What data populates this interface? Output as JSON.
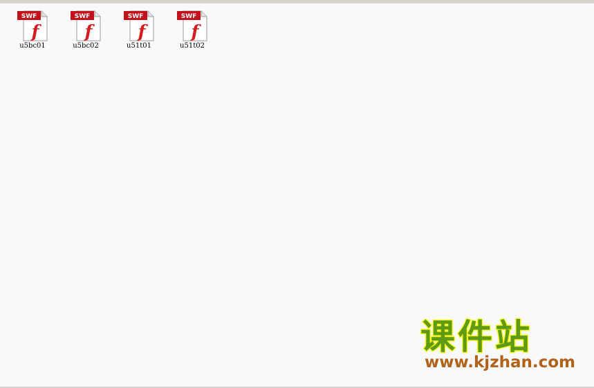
{
  "files": [
    {
      "name": "u5bc01",
      "icon": "swf-file-icon",
      "badge": "SWF"
    },
    {
      "name": "u5bc02",
      "icon": "swf-file-icon",
      "badge": "SWF"
    },
    {
      "name": "u51t01",
      "icon": "swf-file-icon",
      "badge": "SWF"
    },
    {
      "name": "u51t02",
      "icon": "swf-file-icon",
      "badge": "SWF"
    }
  ],
  "watermark": {
    "title": "课件站",
    "url": "www.kjzhan.com"
  },
  "colors": {
    "background": "#f9f9f9",
    "badge_red": "#c1121c",
    "flash_red": "#d71920",
    "watermark_green": "#5e9a13",
    "watermark_outline": "#f5f500",
    "watermark_url": "#b0611a"
  }
}
